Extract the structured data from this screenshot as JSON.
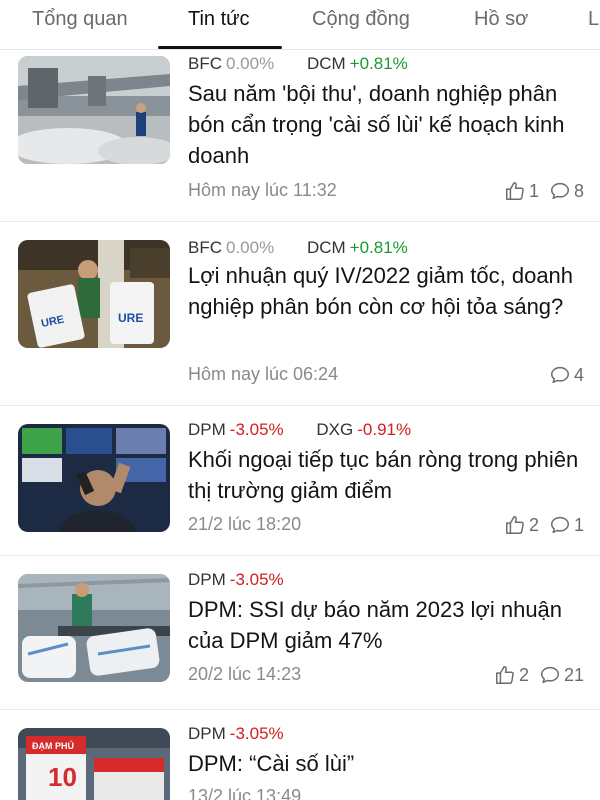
{
  "tabs": [
    {
      "label": "Tổng quan"
    },
    {
      "label": "Tin tức"
    },
    {
      "label": "Cộng đồng"
    },
    {
      "label": "Hồ sơ"
    },
    {
      "label": "L"
    }
  ],
  "active_tab": "Tin tức",
  "articles": [
    {
      "tickers": [
        {
          "symbol": "BFC",
          "change": "0.00%",
          "trend": "flat"
        },
        {
          "symbol": "DCM",
          "change": "+0.81%",
          "trend": "up"
        }
      ],
      "title": "Sau năm 'bội thu', doanh nghiệp phân bón cẩn trọng 'cài số lùi' kế hoạch kinh doanh",
      "time": "Hôm nay lúc 11:32",
      "likes": "1",
      "comments": "8"
    },
    {
      "tickers": [
        {
          "symbol": "BFC",
          "change": "0.00%",
          "trend": "flat"
        },
        {
          "symbol": "DCM",
          "change": "+0.81%",
          "trend": "up"
        }
      ],
      "title": "Lợi nhuận quý IV/2022 giảm tốc, doanh nghiệp phân bón còn cơ hội tỏa sáng?",
      "time": "Hôm nay lúc 06:24",
      "comments": "4"
    },
    {
      "tickers": [
        {
          "symbol": "DPM",
          "change": "-3.05%",
          "trend": "down"
        },
        {
          "symbol": "DXG",
          "change": "-0.91%",
          "trend": "down"
        }
      ],
      "title": "Khối ngoại tiếp tục bán ròng trong phiên thị trường giảm điểm",
      "time": "21/2 lúc 18:20",
      "likes": "2",
      "comments": "1"
    },
    {
      "tickers": [
        {
          "symbol": "DPM",
          "change": "-3.05%",
          "trend": "down"
        }
      ],
      "title": "DPM: SSI dự báo năm 2023 lợi nhuận của DPM giảm 47%",
      "time": "20/2 lúc 14:23",
      "likes": "2",
      "comments": "21"
    },
    {
      "tickers": [
        {
          "symbol": "DPM",
          "change": "-3.05%",
          "trend": "down"
        }
      ],
      "title": "DPM:  “Cài số lùi”",
      "time": "13/2 lúc 13:49"
    }
  ],
  "image_text": {
    "urea_left": "URE",
    "urea_right": "URE",
    "bag_brand": "ĐẠM PHÚ",
    "bag_number": "10"
  },
  "colors": {
    "up": "#1a9a2d",
    "down": "#d11f1f",
    "flat": "#9a9a9a",
    "active_tab": "#111111",
    "inactive_tab": "#6b6b6b"
  },
  "icons": {
    "like": "thumbs-up-icon",
    "comment": "comment-bubble-icon"
  }
}
